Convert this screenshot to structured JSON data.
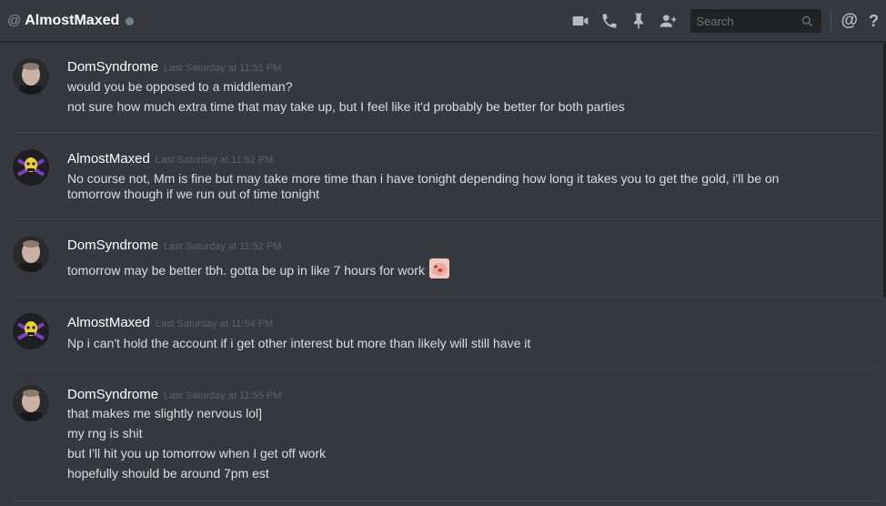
{
  "header": {
    "at_symbol": "@",
    "channel_name": "AlmostMaxed",
    "search_placeholder": "Search",
    "mention_symbol": "@",
    "help_symbol": "?"
  },
  "icons": [
    "video-call-icon",
    "voice-call-icon",
    "pin-icon",
    "add-friend-icon",
    "search-icon",
    "mention-icon",
    "help-icon"
  ],
  "colors": {
    "background": "#36393f",
    "header_border": "#202225",
    "username": "#ffffff",
    "timestamp": "#5e6269",
    "text": "#dcddde",
    "status_offline": "#747f8d"
  },
  "messages": [
    {
      "author": "DomSyndrome",
      "timestamp": "Last Saturday at 11:51 PM",
      "lines": [
        "would you be opposed to a middleman?",
        "not sure how much extra time that may take up, but I feel like it'd probably be better for both parties"
      ]
    },
    {
      "author": "AlmostMaxed",
      "timestamp": "Last Saturday at 11:52 PM",
      "lines": [
        "No course not, Mm is fine but may take more time than i have tonight depending how long it takes you to get the gold, i'll be on",
        "tomorrow though if we run out of time tonight"
      ]
    },
    {
      "author": "DomSyndrome",
      "timestamp": "Last Saturday at 11:52 PM",
      "lines": [
        "tomorrow may be better tbh. gotta be up in like 7 hours for work"
      ]
    },
    {
      "author": "AlmostMaxed",
      "timestamp": "Last Saturday at 11:54 PM",
      "lines": [
        "Np i can't hold the account if i get other interest but more than likely will still have it"
      ]
    },
    {
      "author": "DomSyndrome",
      "timestamp": "Last Saturday at 11:55 PM",
      "lines": [
        "that makes me slightly nervous lol]",
        "my rng is shit",
        "but I'll hit you up tomorrow when I get off work",
        "hopefully should be around 7pm est"
      ]
    }
  ]
}
